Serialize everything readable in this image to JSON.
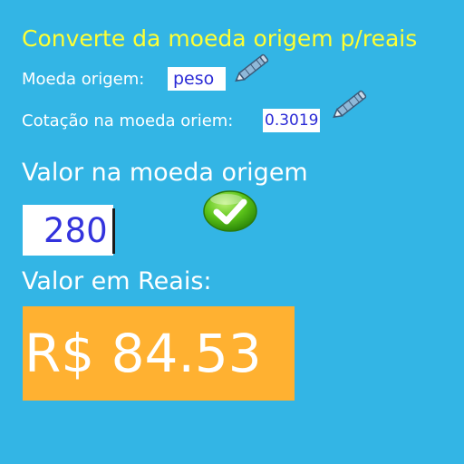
{
  "title": "Converte da moeda origem p/reais",
  "origin_currency": {
    "label": "Moeda origem:",
    "value": "peso",
    "edit_icon": "pencil-icon"
  },
  "exchange_rate": {
    "label": "Cotação na moeda oriem:",
    "value": "0.3019",
    "edit_icon": "pencil-icon"
  },
  "amount": {
    "label": "Valor na moeda origem",
    "value": "280",
    "confirm_icon": "checkmark-icon"
  },
  "result": {
    "label": "Valor em Reais:",
    "value": "R$ 84.53"
  },
  "colors": {
    "background": "#33b5e5",
    "title": "#ffff33",
    "result_background": "#ffb131",
    "field_text": "#3333dd"
  }
}
